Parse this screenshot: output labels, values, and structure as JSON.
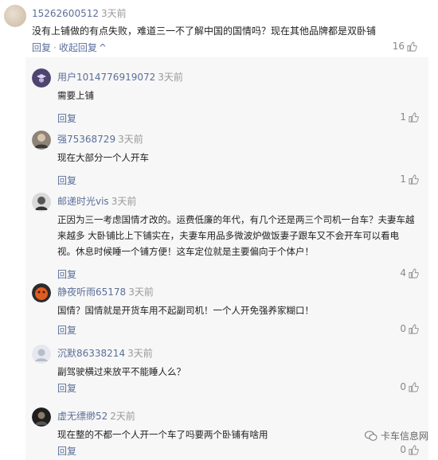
{
  "top_comment": {
    "user": "15262600512",
    "time": "3天前",
    "text": "没有上铺做的有点失败，难道三一不了解中国的国情吗？现在其他品牌都是双卧铺",
    "reply_label": "回复",
    "separator": "·",
    "collapse_label": "收起回复",
    "collapse_icon": "^",
    "likes": "16"
  },
  "replies": [
    {
      "user": "用户1014776919072",
      "time": "3天前",
      "text": "需要上铺",
      "reply_label": "回复",
      "likes": "1"
    },
    {
      "user": "强75368729",
      "time": "3天前",
      "text": "现在大部分一个人开车",
      "reply_label": "回复",
      "likes": "1"
    },
    {
      "user": "邮递时光vis",
      "time": "3天前",
      "text": "正因为三一考虑国情才改的。运费低廉的年代，有几个还是两三个司机一台车？夫妻车越来越多 大卧铺比上下铺实在，夫妻车用品多微波炉做饭妻子跟车又不会开车可以看电视。休息时候睡一个铺方便！这车定位就是主要偏向于个体户！",
      "reply_label": "回复",
      "likes": "4"
    },
    {
      "user": "静夜听雨65178",
      "time": "3天前",
      "text": "国情？国情就是开货车用不起副司机！一个人开免强养家糊口！",
      "reply_label": "回复",
      "likes": "0"
    },
    {
      "user": "沉默86338214",
      "time": "3天前",
      "text": "副驾驶横过来放平不能睡人么？",
      "reply_label": "回复",
      "likes": "0"
    },
    {
      "user": "虚无缥缈52",
      "time": "2天前",
      "text": "现在整的不都一个人开一个车了吗要两个卧铺有啥用",
      "reply_label": "回复",
      "likes": "0"
    }
  ],
  "watermark": "卡车信息网",
  "colors": {
    "link": "#5b6f9a",
    "muted": "#999999",
    "reply_bg": "#f7f7f7"
  }
}
